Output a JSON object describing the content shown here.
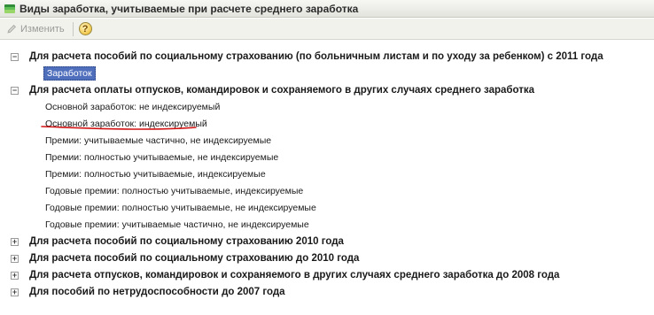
{
  "window": {
    "title": "Виды заработка, учитываемые при расчете среднего заработка"
  },
  "toolbar": {
    "edit_label": "Изменить",
    "help_label": "?"
  },
  "groups": [
    {
      "label": "Для расчета пособий по социальному страхованию (по больничным листам и по уходу за ребенком) с 2011 года",
      "toggle": "−",
      "items": [
        "Заработок"
      ]
    },
    {
      "label": "Для расчета оплаты отпусков, командировок и сохраняемого в других случаях среднего заработка",
      "toggle": "−",
      "items": [
        "Основной заработок: не индексируемый",
        "Основной заработок: индексируемый",
        "Премии: учитываемые частично, не индексируемые",
        "Премии: полностью учитываемые, не индексируемые",
        "Премии: полностью учитываемые, индексируемые",
        "Годовые премии: полностью учитываемые, индексируемые",
        "Годовые премии: полностью учитываемые, не индексируемые",
        "Годовые премии: учитываемые частично, не индексируемые"
      ]
    },
    {
      "label": "Для расчета пособий по социальному страхованию 2010 года",
      "toggle": "+",
      "items": []
    },
    {
      "label": "Для расчета пособий по социальному страхованию до 2010 года",
      "toggle": "+",
      "items": []
    },
    {
      "label": "Для расчета отпусков, командировок и сохраняемого в других случаях среднего заработка до 2008 года",
      "toggle": "+",
      "items": []
    },
    {
      "label": "Для пособий по нетрудоспособности до 2007 года",
      "toggle": "+",
      "items": []
    }
  ],
  "colors": {
    "selection": "#4f6fbd",
    "annotation": "#d21414"
  }
}
